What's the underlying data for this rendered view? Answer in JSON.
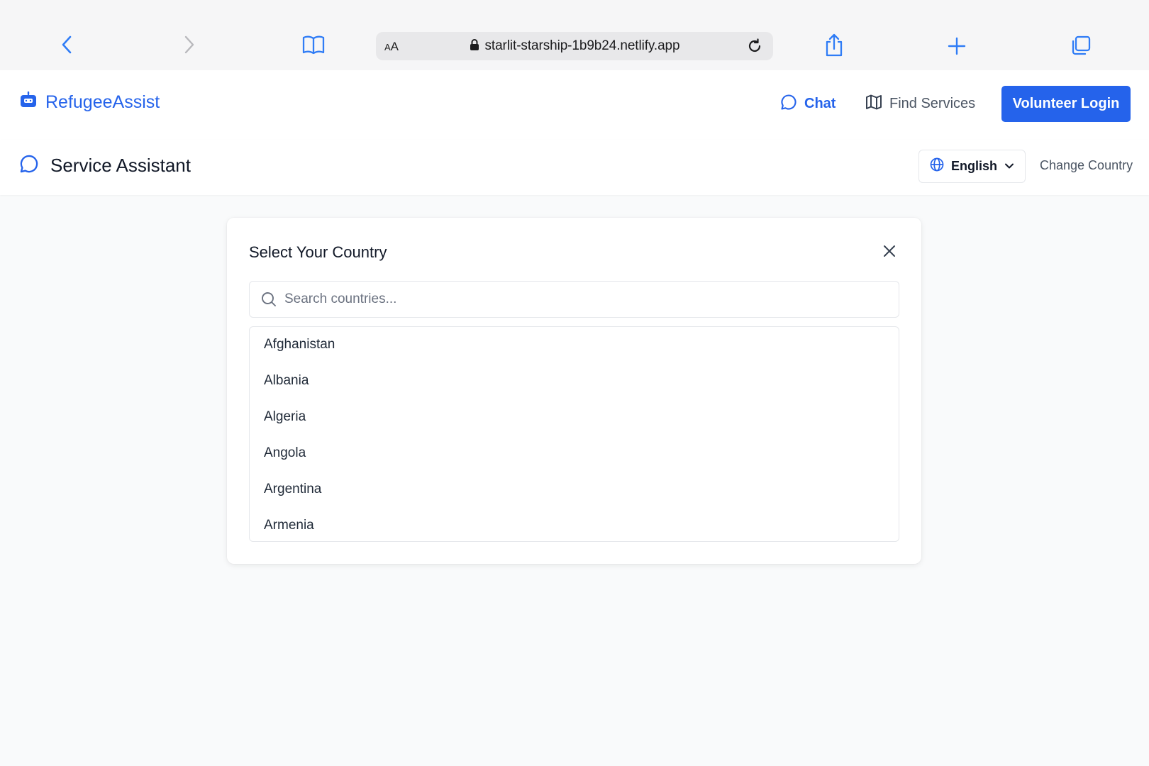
{
  "browser": {
    "text_size_label": "AA",
    "url": "starlit-starship-1b9b24.netlify.app"
  },
  "header": {
    "logo_text": "RefugeeAssist",
    "nav": {
      "chat_label": "Chat",
      "find_services_label": "Find Services"
    },
    "volunteer_login_label": "Volunteer Login"
  },
  "subheader": {
    "title": "Service Assistant",
    "language_selected": "English",
    "change_country_label": "Change Country"
  },
  "modal": {
    "title": "Select Your Country",
    "search_placeholder": "Search countries...",
    "countries": [
      "Afghanistan",
      "Albania",
      "Algeria",
      "Angola",
      "Argentina",
      "Armenia"
    ]
  },
  "colors": {
    "brand": "#2563eb",
    "background": "#f9fafb"
  }
}
